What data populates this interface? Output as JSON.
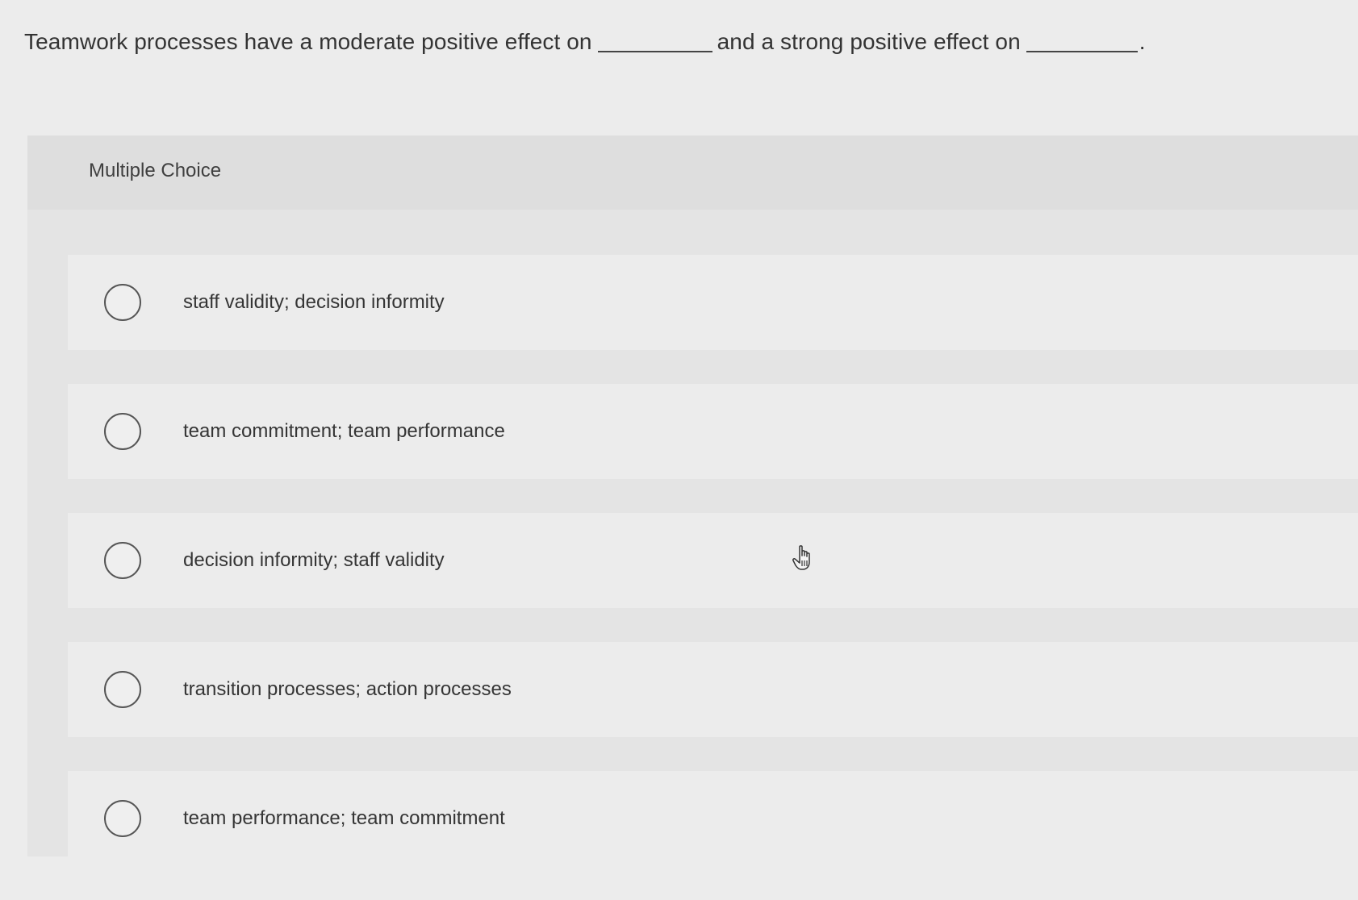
{
  "question": {
    "part1": "Teamwork processes have a moderate positive effect on",
    "part2": "and a strong positive effect on",
    "end": "."
  },
  "multiple_choice": {
    "label": "Multiple Choice",
    "options": [
      {
        "label": "staff validity; decision informity"
      },
      {
        "label": "team commitment; team performance"
      },
      {
        "label": "decision informity; staff validity"
      },
      {
        "label": "transition processes; action processes"
      },
      {
        "label": "team performance; team commitment"
      }
    ]
  },
  "cursor": {
    "icon": "hand-pointer-icon"
  }
}
